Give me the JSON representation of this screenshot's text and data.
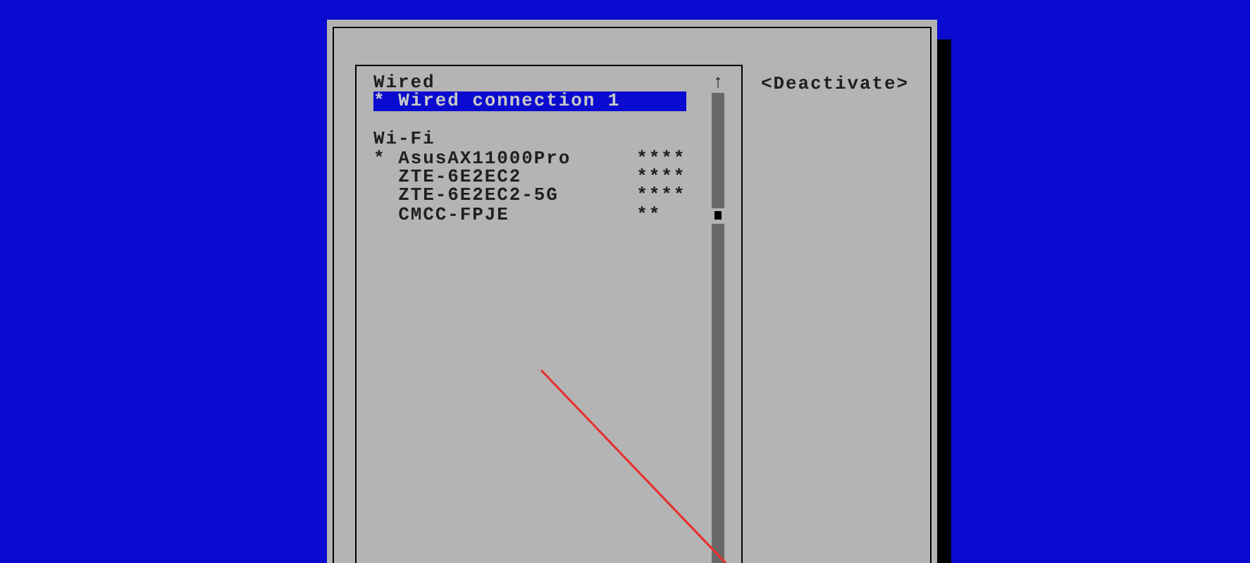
{
  "connection_list": {
    "sections": [
      {
        "heading": "Wired",
        "items": [
          {
            "marker": "*",
            "name": "Wired connection 1",
            "selected": true
          }
        ]
      },
      {
        "heading": "Wi-Fi",
        "items": [
          {
            "marker": "*",
            "name": "AsusAX11000Pro",
            "signal": "****",
            "selected": false
          },
          {
            "name": "ZTE-6E2EC2",
            "signal": "****",
            "selected": false
          },
          {
            "name": "ZTE-6E2EC2-5G",
            "signal": "****",
            "selected": false
          },
          {
            "name": "CMCC-FPJE",
            "signal": "**",
            "selected": false
          }
        ]
      }
    ],
    "scroll_arrow": "↑"
  },
  "actions": [
    "<Deactivate>"
  ]
}
